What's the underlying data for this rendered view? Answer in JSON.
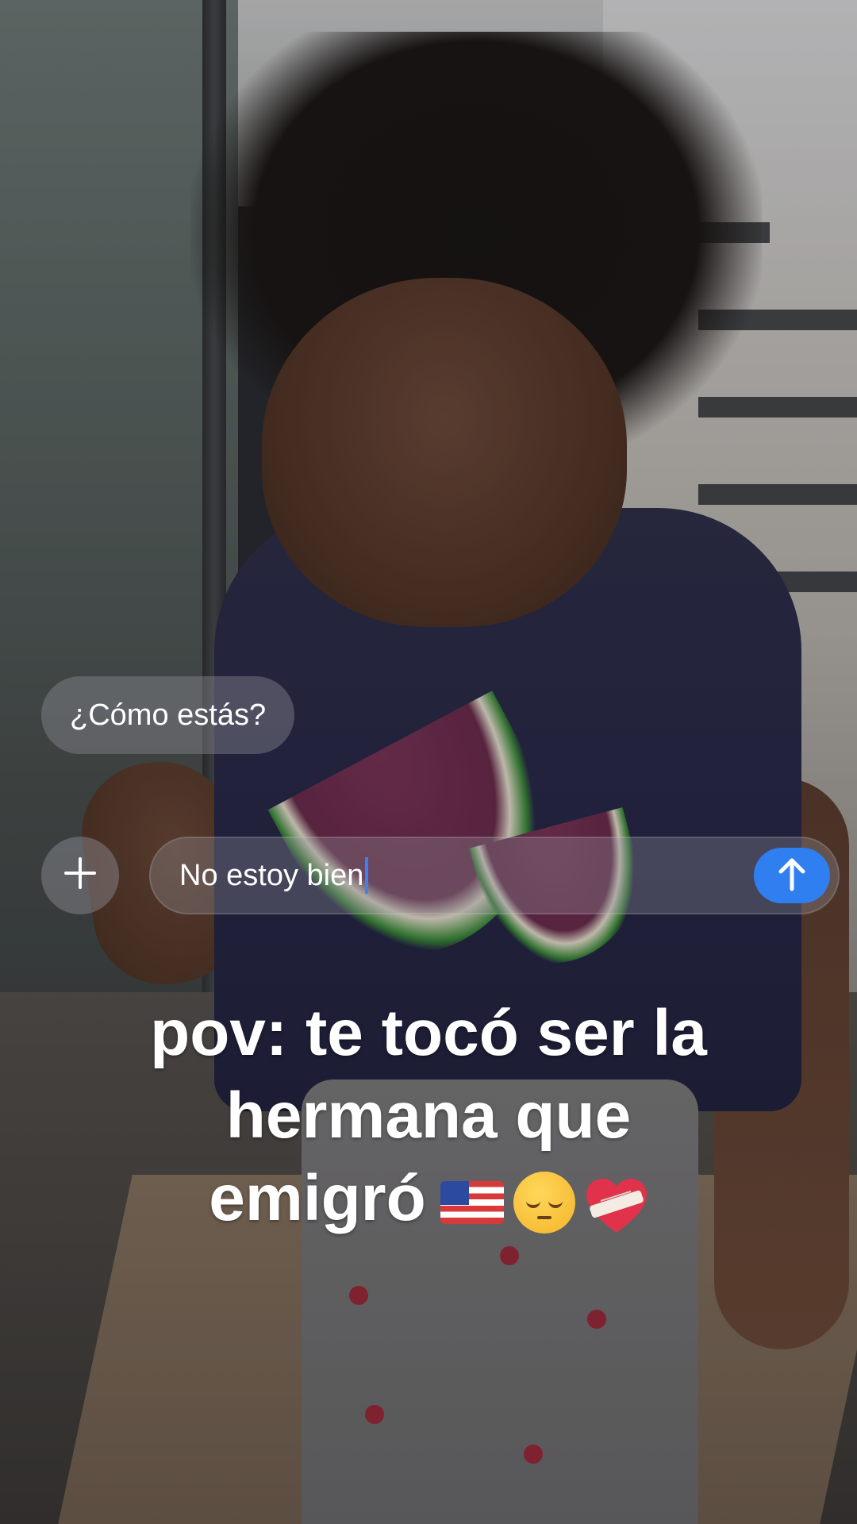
{
  "chat": {
    "received_message": "¿Cómo estás?",
    "input_text": "No estoy bien"
  },
  "caption": {
    "line1": "pov: te tocó ser la",
    "line2": "hermana que",
    "line3": "emigró"
  },
  "icons": {
    "plus": "plus-icon",
    "send": "arrow-up-icon",
    "emojis": [
      "us-flag-emoji",
      "pensive-face-emoji",
      "mending-heart-emoji"
    ]
  },
  "colors": {
    "send_button": "#2f7ff0",
    "caret": "#3b82f6",
    "caption_text": "#ffffff"
  }
}
